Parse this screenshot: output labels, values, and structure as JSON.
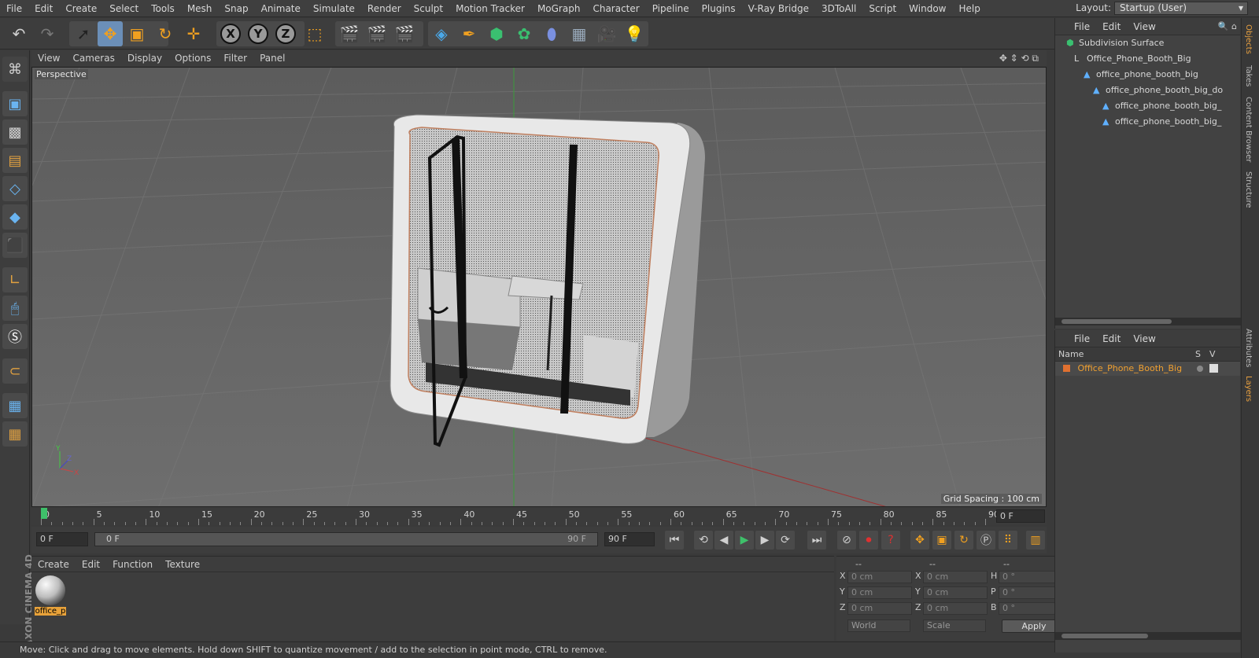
{
  "menubar": {
    "items": [
      "File",
      "Edit",
      "Create",
      "Select",
      "Tools",
      "Mesh",
      "Snap",
      "Animate",
      "Simulate",
      "Render",
      "Sculpt",
      "Motion Tracker",
      "MoGraph",
      "Character",
      "Pipeline",
      "Plugins",
      "V-Ray Bridge",
      "3DToAll",
      "Script",
      "Window",
      "Help"
    ],
    "layout_label": "Layout:",
    "layout_value": "Startup (User)"
  },
  "toolbar": {
    "axis_x": "X",
    "axis_y": "Y",
    "axis_z": "Z"
  },
  "viewport": {
    "menu": [
      "View",
      "Cameras",
      "Display",
      "Options",
      "Filter",
      "Panel"
    ],
    "camera_label": "Perspective",
    "grid_spacing": "Grid Spacing : 100 cm",
    "axis_labels": {
      "x": "X",
      "y": "Y",
      "z": "Z"
    }
  },
  "timeline": {
    "ticks": [
      "0",
      "5",
      "10",
      "15",
      "20",
      "25",
      "30",
      "35",
      "40",
      "45",
      "50",
      "55",
      "60",
      "65",
      "70",
      "75",
      "80",
      "85",
      "90"
    ],
    "current_frame": "0 F",
    "start_field": "0 F",
    "slider_start": "0 F",
    "slider_end": "90 F",
    "end_field": "90 F"
  },
  "material_panel": {
    "menu": [
      "Create",
      "Edit",
      "Function",
      "Texture"
    ],
    "material_name": "office_p"
  },
  "coordinates": {
    "headers": [
      "--",
      "--",
      "--"
    ],
    "rows": [
      {
        "a": "X",
        "av": "0 cm",
        "b": "X",
        "bv": "0 cm",
        "c": "H",
        "cv": "0 °"
      },
      {
        "a": "Y",
        "av": "0 cm",
        "b": "Y",
        "bv": "0 cm",
        "c": "P",
        "cv": "0 °"
      },
      {
        "a": "Z",
        "av": "0 cm",
        "b": "Z",
        "bv": "0 cm",
        "c": "B",
        "cv": "0 °"
      }
    ],
    "world": "World",
    "scale": "Scale",
    "apply": "Apply"
  },
  "objects_panel": {
    "menu": [
      "File",
      "Edit",
      "View"
    ],
    "tree": [
      {
        "label": "Subdivision Surface",
        "indent": 0,
        "icon": "subdivision-icon"
      },
      {
        "label": "Office_Phone_Booth_Big",
        "indent": 1,
        "icon": "null-icon"
      },
      {
        "label": "office_phone_booth_big",
        "indent": 2,
        "icon": "polygon-icon"
      },
      {
        "label": "office_phone_booth_big_do",
        "indent": 3,
        "icon": "polygon-icon"
      },
      {
        "label": "office_phone_booth_big_",
        "indent": 4,
        "icon": "polygon-icon"
      },
      {
        "label": "office_phone_booth_big_",
        "indent": 4,
        "icon": "polygon-icon"
      }
    ]
  },
  "layers_panel": {
    "menu": [
      "File",
      "Edit",
      "View"
    ],
    "col_name": "Name",
    "col_s": "S",
    "col_v": "V",
    "layer_name": "Office_Phone_Booth_Big",
    "layer_color": "#e07030"
  },
  "side_tabs": [
    "Objects",
    "Takes",
    "Content Browser",
    "Structure",
    "Attributes",
    "Layers"
  ],
  "status": "Move: Click and drag to move elements. Hold down SHIFT to quantize movement / add to the selection in point mode, CTRL to remove.",
  "brand": "MAXON CINEMA 4D",
  "colors": {
    "accent": "#6b8fb8",
    "highlight": "#e8a23a",
    "viewport_bg": "#6b6b6b"
  }
}
